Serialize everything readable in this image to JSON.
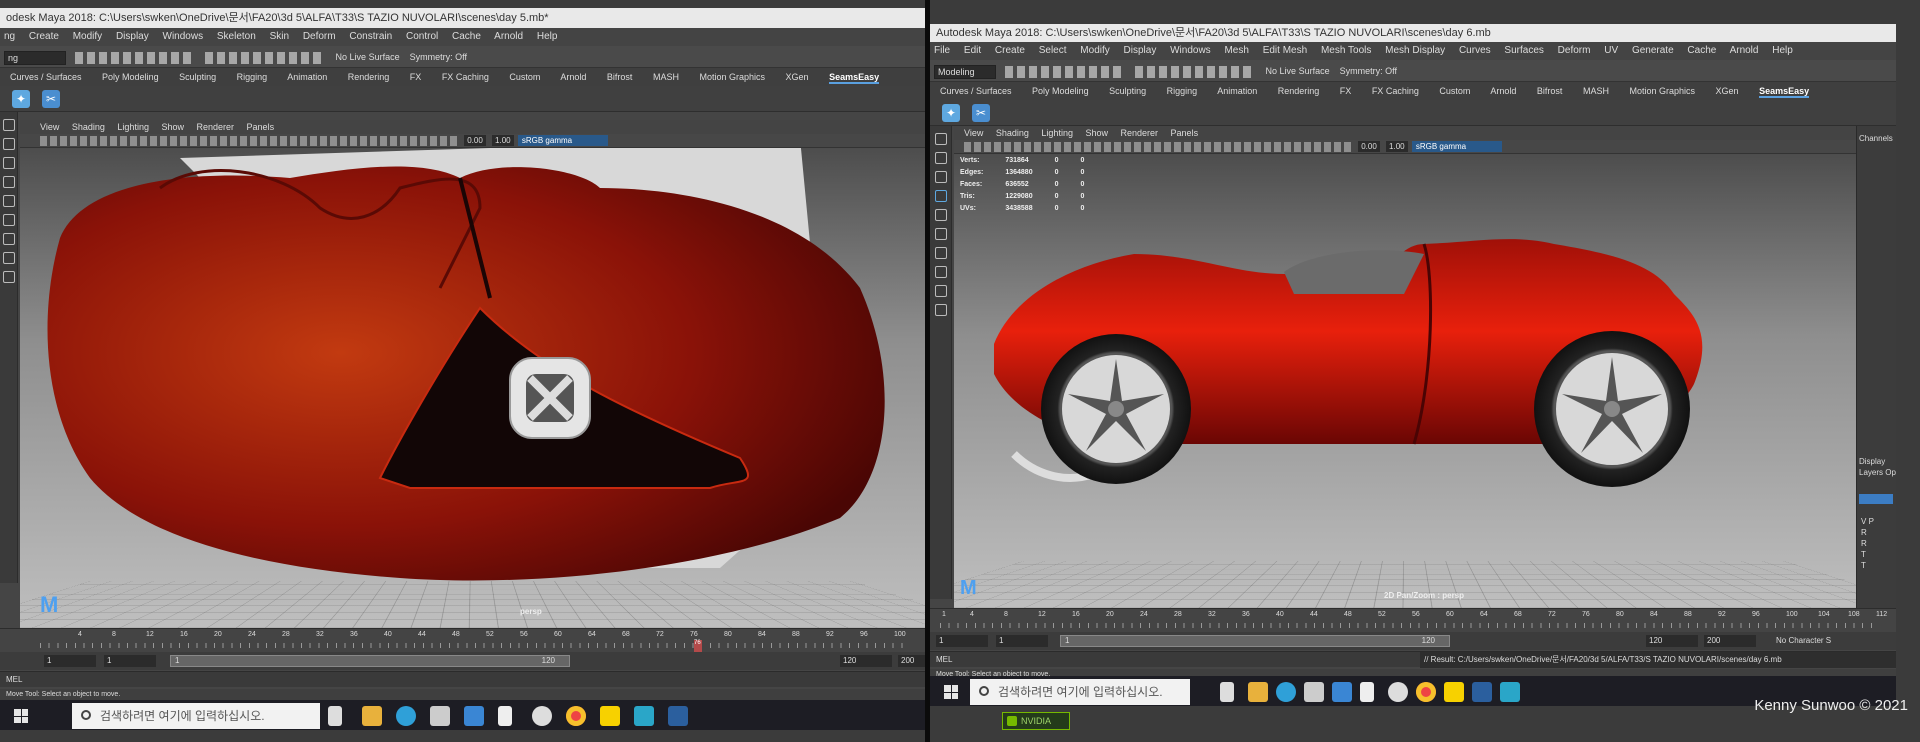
{
  "left_window": {
    "title": "odesk Maya 2018: C:\\Users\\swken\\OneDrive\\문서\\FA20\\3d 5\\ALFA\\T33\\S TAZIO NUVOLARI\\scenes\\day 5.mb*",
    "menu": [
      "ng",
      "Create",
      "Modify",
      "Display",
      "Windows",
      "Skeleton",
      "Skin",
      "Deform",
      "Constrain",
      "Control",
      "Cache",
      "Arnold",
      "Help"
    ],
    "mode": "ng",
    "live_surface": "No Live Surface",
    "symmetry": "Symmetry: Off",
    "shelf_tabs": [
      "Curves / Surfaces",
      "Poly Modeling",
      "Sculpting",
      "Rigging",
      "Animation",
      "Rendering",
      "FX",
      "FX Caching",
      "Custom",
      "Arnold",
      "Bifrost",
      "MASH",
      "Motion Graphics",
      "XGen",
      "SeamsEasy"
    ],
    "active_shelf": "SeamsEasy",
    "panel_menu": [
      "View",
      "Shading",
      "Lighting",
      "Show",
      "Renderer",
      "Panels"
    ],
    "exposure": "0.00",
    "gamma_value": "1.00",
    "color_space": "sRGB gamma",
    "camera": "persp",
    "time_ticks": [
      "4",
      "8",
      "12",
      "16",
      "20",
      "24",
      "28",
      "32",
      "36",
      "40",
      "44",
      "48",
      "52",
      "56",
      "60",
      "64",
      "68",
      "72",
      "76",
      "80",
      "84",
      "88",
      "92",
      "96",
      "100"
    ],
    "current_frame": "76",
    "range": {
      "start": "1",
      "start2": "1",
      "bar_start": "1",
      "bar_end": "120",
      "end": "120",
      "end2": "200"
    },
    "cmd_label": "MEL",
    "help": "Move Tool: Select an object to move."
  },
  "right_window": {
    "title": "Autodesk Maya 2018: C:\\Users\\swken\\OneDrive\\문서\\FA20\\3d 5\\ALFA\\T33\\S TAZIO NUVOLARI\\scenes\\day 6.mb",
    "menu": [
      "File",
      "Edit",
      "Create",
      "Select",
      "Modify",
      "Display",
      "Windows",
      "Mesh",
      "Edit Mesh",
      "Mesh Tools",
      "Mesh Display",
      "Curves",
      "Surfaces",
      "Deform",
      "UV",
      "Generate",
      "Cache",
      "Arnold",
      "Help"
    ],
    "mode": "Modeling",
    "live_surface": "No Live Surface",
    "symmetry": "Symmetry: Off",
    "shelf_tabs": [
      "Curves / Surfaces",
      "Poly Modeling",
      "Sculpting",
      "Rigging",
      "Animation",
      "Rendering",
      "FX",
      "FX Caching",
      "Custom",
      "Arnold",
      "Bifrost",
      "MASH",
      "Motion Graphics",
      "XGen",
      "SeamsEasy"
    ],
    "active_shelf": "SeamsEasy",
    "panel_menu": [
      "View",
      "Shading",
      "Lighting",
      "Show",
      "Renderer",
      "Panels"
    ],
    "exposure": "0.00",
    "gamma_value": "1.00",
    "color_space": "sRGB gamma",
    "hud": [
      {
        "label": "Verts:",
        "a": "731864",
        "b": "0",
        "c": "0"
      },
      {
        "label": "Edges:",
        "a": "1364880",
        "b": "0",
        "c": "0"
      },
      {
        "label": "Faces:",
        "a": "636552",
        "b": "0",
        "c": "0"
      },
      {
        "label": "Tris:",
        "a": "1229080",
        "b": "0",
        "c": "0"
      },
      {
        "label": "UVs:",
        "a": "3438588",
        "b": "0",
        "c": "0"
      }
    ],
    "camera": "2D Pan/Zoom : persp",
    "channels_label": "Channels",
    "display_tabs": [
      "Display",
      "Layers",
      "Op"
    ],
    "layer_letters": [
      "V",
      "P",
      "R",
      "R",
      "T",
      "T"
    ],
    "time_ticks": [
      "1",
      "4",
      "8",
      "12",
      "16",
      "20",
      "24",
      "28",
      "32",
      "36",
      "40",
      "44",
      "48",
      "52",
      "56",
      "60",
      "64",
      "68",
      "72",
      "76",
      "80",
      "84",
      "88",
      "92",
      "96",
      "100",
      "104",
      "108",
      "112"
    ],
    "range": {
      "start": "1",
      "start2": "1",
      "bar_start": "1",
      "bar_end": "120",
      "end": "120",
      "end2": "200"
    },
    "no_char": "No Character S",
    "cmd_label": "MEL",
    "result": "// Result: C:/Users/swken/OneDrive/문서/FA20/3d 5/ALFA/T33/S TAZIO NUVOLARI/scenes/day 6.mb",
    "help": "Move Tool: Select an object to move."
  },
  "taskbar": {
    "search_placeholder": "검색하려면 여기에 입력하십시오."
  },
  "nvidia_label": "NVIDIA",
  "signature": "Kenny Sunwoo © 2021"
}
